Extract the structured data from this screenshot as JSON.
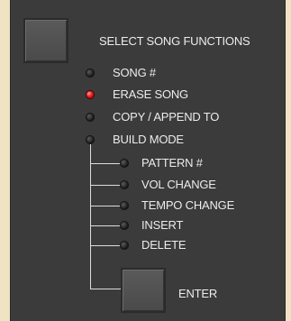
{
  "panel": {
    "title": "SELECT SONG FUNCTIONS",
    "functions": [
      {
        "label": "SONG #",
        "active": false
      },
      {
        "label": "ERASE SONG",
        "active": true
      },
      {
        "label": "COPY / APPEND TO",
        "active": false
      },
      {
        "label": "BUILD MODE",
        "active": false
      }
    ],
    "build_options": [
      {
        "label": "PATTERN #",
        "active": false
      },
      {
        "label": "VOL CHANGE",
        "active": false
      },
      {
        "label": "TEMPO CHANGE",
        "active": false
      },
      {
        "label": "INSERT",
        "active": false
      },
      {
        "label": "DELETE",
        "active": false
      }
    ],
    "enter_label": "ENTER",
    "colors": {
      "led_on": "#e02020",
      "led_off": "#1a1a1a",
      "panel_bg": "#3b3b3b",
      "page_bg": "#efe3c4"
    }
  }
}
